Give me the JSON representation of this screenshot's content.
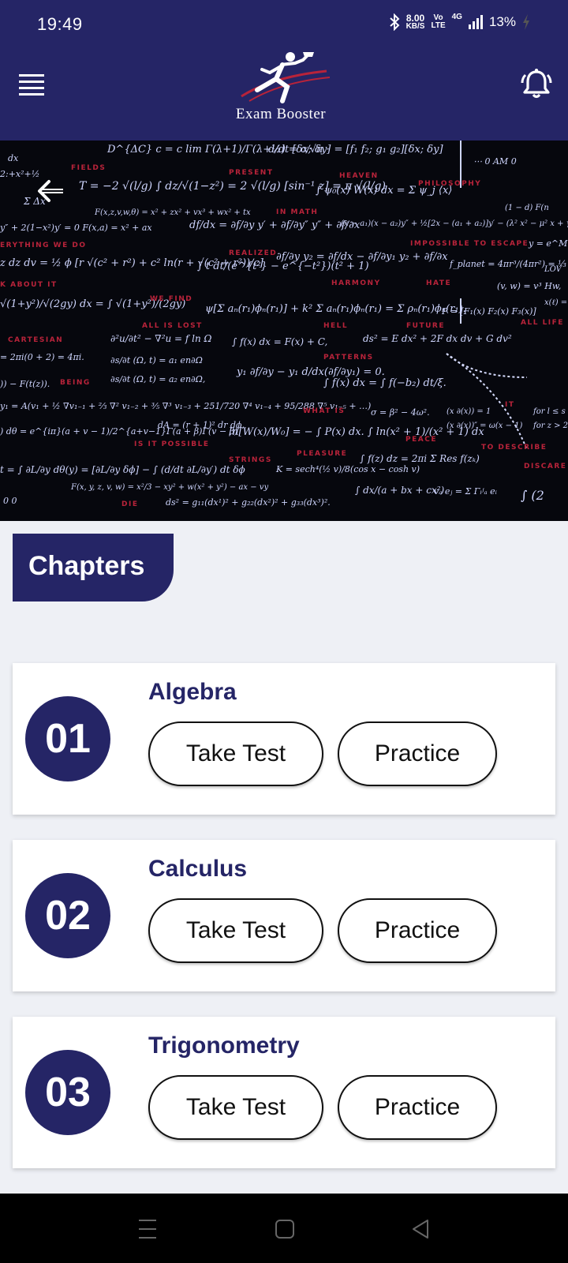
{
  "status_bar": {
    "time": "19:49",
    "speed_value": "8.00",
    "speed_unit": "KB/S",
    "volte": "Vo",
    "volte_sub": "LTE",
    "network": "4G",
    "battery": "13%",
    "icons": [
      "bluetooth-icon",
      "signal-icon",
      "battery-charging-icon"
    ]
  },
  "header": {
    "app_name": "Exam Booster",
    "menu_icon": "hamburger-icon",
    "bell_icon": "notification-bell-icon"
  },
  "banner": {
    "back_icon": "back-arrow-icon"
  },
  "section": {
    "label": "Chapters"
  },
  "chapters": [
    {
      "number": "01",
      "title": "Algebra",
      "take_test": "Take Test",
      "practice": "Practice"
    },
    {
      "number": "02",
      "title": "Calculus",
      "take_test": "Take Test",
      "practice": "Practice"
    },
    {
      "number": "03",
      "title": "Trigonometry",
      "take_test": "Take Test",
      "practice": "Practice"
    }
  ],
  "colors": {
    "primary": "#252566",
    "background": "#eef0f5",
    "card": "#ffffff",
    "banner": "#06070d"
  },
  "nav_bar": {
    "icons": [
      "recents-icon",
      "home-icon",
      "back-nav-icon"
    ]
  }
}
